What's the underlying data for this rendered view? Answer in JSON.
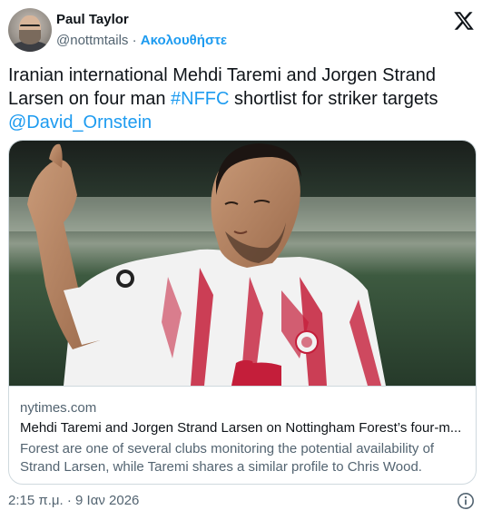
{
  "author": {
    "name": "Paul Taylor",
    "handle": "@nottmtails",
    "separator": "·",
    "follow_label": "Ακολουθήστε"
  },
  "tweet": {
    "text_line_1": "Iranian international Mehdi Taremi and Jorgen Strand",
    "text_line_2_prefix": "Larsen on four man ",
    "hashtag": "#NFFC",
    "text_line_2_suffix": " shortlist for striker targets",
    "mention": "@David_Ornstein"
  },
  "card": {
    "domain": "nytimes.com",
    "title": "Mehdi Taremi and Jorgen Strand Larsen on Nottingham Forest’s four-m...",
    "description": "Forest are one of several clubs monitoring the potential availability of Strand Larsen, while Taremi shares a similar profile to Chris Wood.",
    "image_alt": "photo of a footballer in a red and white striped kit pointing upward"
  },
  "footer": {
    "timestamp": "2:15 π.μ. · 9 Ιαν 2026"
  },
  "icons": {
    "logo": "x-logo-icon",
    "info": "info-icon"
  },
  "colors": {
    "accent": "#1d9bf0",
    "text": "#0f1419",
    "secondary_text": "#536471",
    "border": "#cfd9de",
    "kit_red": "#c41e3a"
  }
}
